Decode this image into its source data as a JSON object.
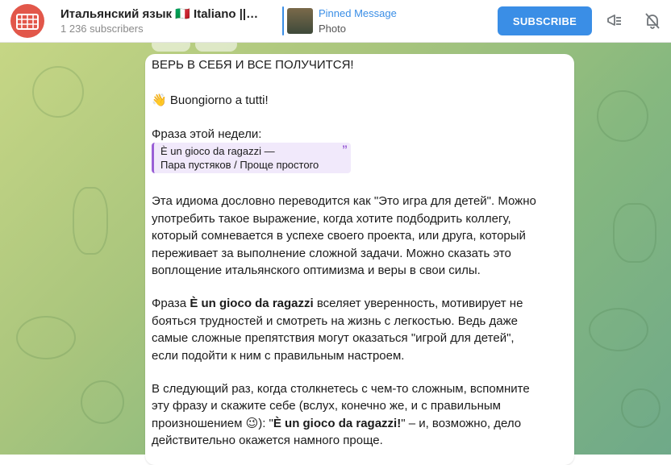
{
  "header": {
    "title": "Итальянский язык 🇮🇹 Italiano ||…",
    "subscribers": "1 236 subscribers",
    "pinned_label": "Pinned Message",
    "pinned_sub": "Photo",
    "subscribe_label": "SUBSCRIBE",
    "icons": [
      "megaphone-settings-icon",
      "bell-off-icon"
    ]
  },
  "message": {
    "line1": "ВЕРЬ В СЕБЯ И ВСЕ ПОЛУЧИТСЯ!",
    "greeting_emoji": "👋",
    "greeting": "Buongiorno a tutti!",
    "phrase_week": "Фраза этой недели:",
    "quote_line1": "È un gioco da ragazzi —",
    "quote_line2": "Пара пустяков / Проще простого",
    "quote_mark": "”",
    "p1_l1": "Эта идиома дословно переводится как \"Это игра для детей\". Можно",
    "p1_l2": "употребить такое выражение, когда хотите подбодрить коллегу,",
    "p1_l3": "который сомневается в успехе своего проекта, или друга, который",
    "p1_l4": "переживает за выполнение сложной задачи. Можно сказать это",
    "p1_l5": "воплощение итальянского оптимизма и веры в свои силы.",
    "p2_l1_a": "Фраза ",
    "p2_l1_b": "È un gioco da ragazzi",
    "p2_l1_c": " вселяет уверенность, мотивирует не",
    "p2_l2": "бояться трудностей и смотреть на жизнь с легкостью. Ведь даже",
    "p2_l3": "самые сложные препятствия могут оказаться \"игрой для детей\",",
    "p2_l4": "если подойти к ним с правильным настроем.",
    "p3_l1": "В следующий раз, когда столкнетесь с чем-то сложным, вспомните",
    "p3_l2": "эту фразу и скажите себе (вслух, конечно же, и с правильным",
    "p3_l3_a": "произношением ",
    "p3_l3_emoji": "😉",
    "p3_l3_b": "): \"",
    "p3_l3_c": "È un gioco da ragazzi!",
    "p3_l3_d": "\" – и, возможно, дело",
    "p3_l4": "действительно окажется намного проще."
  },
  "colors": {
    "accent": "#3a8ee6",
    "quote_accent": "#9a5fd6",
    "avatar": "#e2574a"
  }
}
